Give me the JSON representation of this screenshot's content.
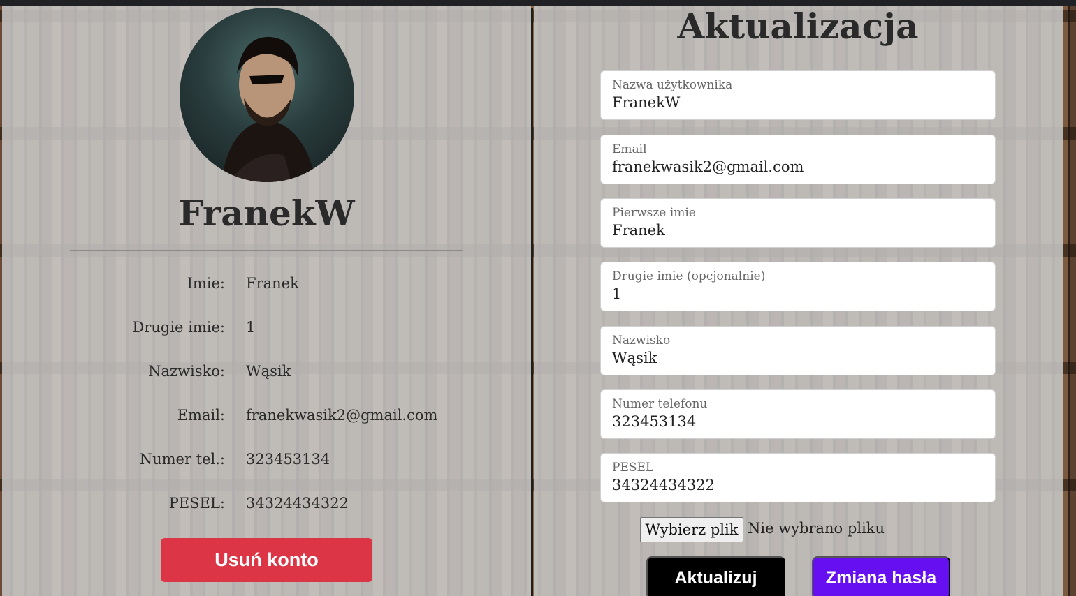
{
  "profile": {
    "username": "FranekW",
    "rows": [
      {
        "label": "Imie:",
        "value": "Franek"
      },
      {
        "label": "Drugie imie:",
        "value": "1"
      },
      {
        "label": "Nazwisko:",
        "value": "Wąsik"
      },
      {
        "label": "Email:",
        "value": "franekwasik2@gmail.com"
      },
      {
        "label": "Numer tel.:",
        "value": "323453134"
      },
      {
        "label": "PESEL:",
        "value": "34324434322"
      }
    ],
    "delete_label": "Usuń konto"
  },
  "form": {
    "title": "Aktualizacja",
    "fields": [
      {
        "label": "Nazwa użytkownika",
        "value": "FranekW"
      },
      {
        "label": "Email",
        "value": "franekwasik2@gmail.com"
      },
      {
        "label": "Pierwsze imie",
        "value": "Franek"
      },
      {
        "label": "Drugie imie (opcjonalnie)",
        "value": "1"
      },
      {
        "label": "Nazwisko",
        "value": "Wąsik"
      },
      {
        "label": "Numer telefonu",
        "value": "323453134"
      },
      {
        "label": "PESEL",
        "value": "34324434322"
      }
    ],
    "file_button_label": "Wybierz plik",
    "file_status": "Nie wybrano pliku",
    "update_label": "Aktualizuj",
    "change_password_label": "Zmiana hasła"
  },
  "colors": {
    "delete": "#dc3545",
    "update": "#000000",
    "change_password": "#6610f2"
  }
}
